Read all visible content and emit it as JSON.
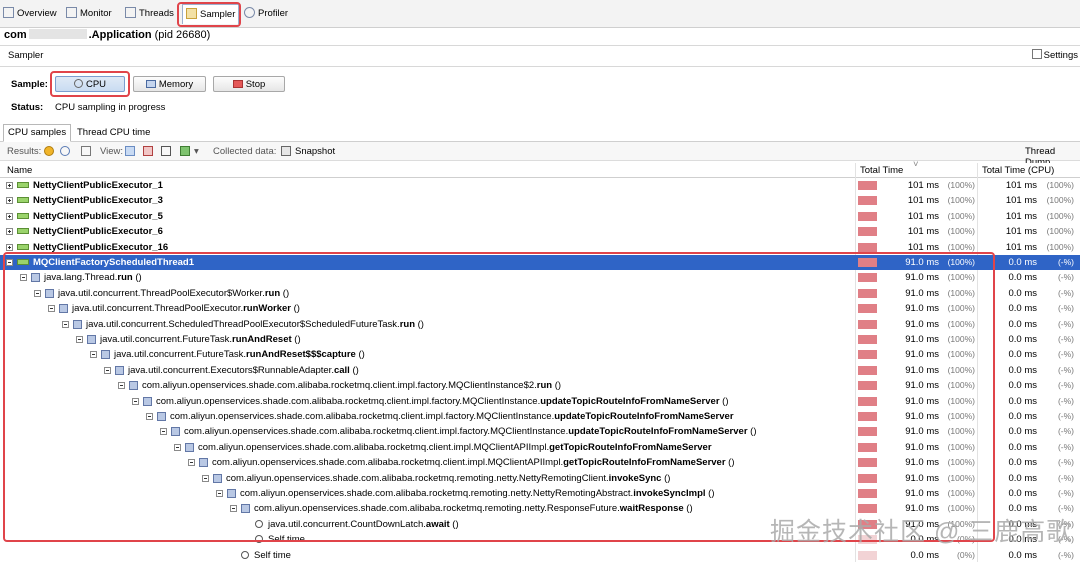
{
  "tabs": [
    {
      "label": "Overview",
      "icon": "overview-icon"
    },
    {
      "label": "Monitor",
      "icon": "monitor-icon"
    },
    {
      "label": "Threads",
      "icon": "threads-icon"
    },
    {
      "label": "Sampler",
      "icon": "sampler-icon"
    },
    {
      "label": "Profiler",
      "icon": "profiler-icon"
    }
  ],
  "app": {
    "title_prefix": "com",
    "title_suffix": ".Application",
    "pid": "(pid 26680)"
  },
  "panel": {
    "label": "Sampler",
    "settings": "Settings"
  },
  "sample": {
    "label": "Sample:",
    "cpu": "CPU",
    "memory": "Memory",
    "stop": "Stop"
  },
  "status": {
    "label": "Status:",
    "value": "CPU sampling in progress"
  },
  "subtabs": [
    "CPU samples",
    "Thread CPU time"
  ],
  "toolbar": {
    "results": "Results:",
    "view": "View:",
    "collected": "Collected data:",
    "snapshot": "Snapshot",
    "thread_dump": "Thread Dump"
  },
  "columns": {
    "name": "Name",
    "total": "Total Time",
    "total_cpu": "Total Time (CPU)"
  },
  "rows": [
    {
      "name": "NettyClientPublicExecutor_1",
      "bold": "",
      "suffix": "",
      "type": "thread",
      "depth": 0,
      "ms": "101 ms",
      "pct": "(100%)",
      "cms": "101 ms",
      "cpct": "(100%)",
      "bar": "full"
    },
    {
      "name": "NettyClientPublicExecutor_3",
      "bold": "",
      "suffix": "",
      "type": "thread",
      "depth": 0,
      "ms": "101 ms",
      "pct": "(100%)",
      "cms": "101 ms",
      "cpct": "(100%)",
      "bar": "full"
    },
    {
      "name": "NettyClientPublicExecutor_5",
      "bold": "",
      "suffix": "",
      "type": "thread",
      "depth": 0,
      "ms": "101 ms",
      "pct": "(100%)",
      "cms": "101 ms",
      "cpct": "(100%)",
      "bar": "full"
    },
    {
      "name": "NettyClientPublicExecutor_6",
      "bold": "",
      "suffix": "",
      "type": "thread",
      "depth": 0,
      "ms": "101 ms",
      "pct": "(100%)",
      "cms": "101 ms",
      "cpct": "(100%)",
      "bar": "full"
    },
    {
      "name": "NettyClientPublicExecutor_16",
      "bold": "",
      "suffix": "",
      "type": "thread",
      "depth": 0,
      "ms": "101 ms",
      "pct": "(100%)",
      "cms": "101 ms",
      "cpct": "(100%)",
      "bar": "full"
    },
    {
      "name": "MQClientFactoryScheduledThread1",
      "bold": "",
      "suffix": "",
      "type": "thread",
      "depth": 0,
      "ms": "91.0 ms",
      "pct": "(100%)",
      "cms": "0.0 ms",
      "cpct": "(-%)",
      "bar": "full",
      "selected": true
    },
    {
      "name": "java.lang.Thread.",
      "bold": "run",
      "suffix": " ()",
      "type": "method",
      "depth": 1,
      "ms": "91.0 ms",
      "pct": "(100%)",
      "cms": "0.0 ms",
      "cpct": "(-%)",
      "bar": "full"
    },
    {
      "name": "java.util.concurrent.ThreadPoolExecutor$Worker.",
      "bold": "run",
      "suffix": " ()",
      "type": "method",
      "depth": 2,
      "ms": "91.0 ms",
      "pct": "(100%)",
      "cms": "0.0 ms",
      "cpct": "(-%)",
      "bar": "full"
    },
    {
      "name": "java.util.concurrent.ThreadPoolExecutor.",
      "bold": "runWorker",
      "suffix": " ()",
      "type": "method",
      "depth": 3,
      "ms": "91.0 ms",
      "pct": "(100%)",
      "cms": "0.0 ms",
      "cpct": "(-%)",
      "bar": "full"
    },
    {
      "name": "java.util.concurrent.ScheduledThreadPoolExecutor$ScheduledFutureTask.",
      "bold": "run",
      "suffix": " ()",
      "type": "method",
      "depth": 4,
      "ms": "91.0 ms",
      "pct": "(100%)",
      "cms": "0.0 ms",
      "cpct": "(-%)",
      "bar": "full"
    },
    {
      "name": "java.util.concurrent.FutureTask.",
      "bold": "runAndReset",
      "suffix": " ()",
      "type": "method",
      "depth": 5,
      "ms": "91.0 ms",
      "pct": "(100%)",
      "cms": "0.0 ms",
      "cpct": "(-%)",
      "bar": "full"
    },
    {
      "name": "java.util.concurrent.FutureTask.",
      "bold": "runAndReset$$$capture",
      "suffix": " ()",
      "type": "method",
      "depth": 6,
      "ms": "91.0 ms",
      "pct": "(100%)",
      "cms": "0.0 ms",
      "cpct": "(-%)",
      "bar": "full"
    },
    {
      "name": "java.util.concurrent.Executors$RunnableAdapter.",
      "bold": "call",
      "suffix": " ()",
      "type": "method",
      "depth": 7,
      "ms": "91.0 ms",
      "pct": "(100%)",
      "cms": "0.0 ms",
      "cpct": "(-%)",
      "bar": "full"
    },
    {
      "name": "com.aliyun.openservices.shade.com.alibaba.rocketmq.client.impl.factory.MQClientInstance$2.",
      "bold": "run",
      "suffix": " ()",
      "type": "method",
      "depth": 8,
      "ms": "91.0 ms",
      "pct": "(100%)",
      "cms": "0.0 ms",
      "cpct": "(-%)",
      "bar": "full"
    },
    {
      "name": "com.aliyun.openservices.shade.com.alibaba.rocketmq.client.impl.factory.MQClientInstance.",
      "bold": "updateTopicRouteInfoFromNameServer",
      "suffix": " ()",
      "type": "method",
      "depth": 9,
      "ms": "91.0 ms",
      "pct": "(100%)",
      "cms": "0.0 ms",
      "cpct": "(-%)",
      "bar": "full"
    },
    {
      "name": "com.aliyun.openservices.shade.com.alibaba.rocketmq.client.impl.factory.MQClientInstance.",
      "bold": "updateTopicRouteInfoFromNameServer",
      "suffix": "",
      "type": "method",
      "depth": 10,
      "ms": "91.0 ms",
      "pct": "(100%)",
      "cms": "0.0 ms",
      "cpct": "(-%)",
      "bar": "full"
    },
    {
      "name": "com.aliyun.openservices.shade.com.alibaba.rocketmq.client.impl.factory.MQClientInstance.",
      "bold": "updateTopicRouteInfoFromNameServer",
      "suffix": " ()",
      "type": "method",
      "depth": 11,
      "ms": "91.0 ms",
      "pct": "(100%)",
      "cms": "0.0 ms",
      "cpct": "(-%)",
      "bar": "full"
    },
    {
      "name": "com.aliyun.openservices.shade.com.alibaba.rocketmq.client.impl.MQClientAPIImpl.",
      "bold": "getTopicRouteInfoFromNameServer",
      "suffix": "",
      "type": "method",
      "depth": 12,
      "ms": "91.0 ms",
      "pct": "(100%)",
      "cms": "0.0 ms",
      "cpct": "(-%)",
      "bar": "full"
    },
    {
      "name": "com.aliyun.openservices.shade.com.alibaba.rocketmq.client.impl.MQClientAPIImpl.",
      "bold": "getTopicRouteInfoFromNameServer",
      "suffix": " ()",
      "type": "method",
      "depth": 13,
      "ms": "91.0 ms",
      "pct": "(100%)",
      "cms": "0.0 ms",
      "cpct": "(-%)",
      "bar": "full"
    },
    {
      "name": "com.aliyun.openservices.shade.com.alibaba.rocketmq.remoting.netty.NettyRemotingClient.",
      "bold": "invokeSync",
      "suffix": " ()",
      "type": "method",
      "depth": 14,
      "ms": "91.0 ms",
      "pct": "(100%)",
      "cms": "0.0 ms",
      "cpct": "(-%)",
      "bar": "full"
    },
    {
      "name": "com.aliyun.openservices.shade.com.alibaba.rocketmq.remoting.netty.NettyRemotingAbstract.",
      "bold": "invokeSyncImpl",
      "suffix": " ()",
      "type": "method",
      "depth": 15,
      "ms": "91.0 ms",
      "pct": "(100%)",
      "cms": "0.0 ms",
      "cpct": "(-%)",
      "bar": "full"
    },
    {
      "name": "com.aliyun.openservices.shade.com.alibaba.rocketmq.remoting.netty.ResponseFuture.",
      "bold": "waitResponse",
      "suffix": " ()",
      "type": "method",
      "depth": 16,
      "ms": "91.0 ms",
      "pct": "(100%)",
      "cms": "0.0 ms",
      "cpct": "(-%)",
      "bar": "full"
    },
    {
      "name": "java.util.concurrent.CountDownLatch.",
      "bold": "await",
      "suffix": " ()",
      "type": "clock",
      "depth": 17,
      "ms": "91.0 ms",
      "pct": "(100%)",
      "cms": "0.0 ms",
      "cpct": "(-%)",
      "bar": "full"
    },
    {
      "name": "Self time",
      "bold": "",
      "suffix": "",
      "type": "clock",
      "depth": 17,
      "ms": "0.0 ms",
      "pct": "(0%)",
      "cms": "0.0 ms",
      "cpct": "(-%)",
      "bar": "empty"
    },
    {
      "name": "Self time",
      "bold": "",
      "suffix": "",
      "type": "clock",
      "depth": 16,
      "ms": "0.0 ms",
      "pct": "(0%)",
      "cms": "0.0 ms",
      "cpct": "(-%)",
      "bar": "empty"
    }
  ],
  "watermark": "掘金技术社区 @ 三鹿高歌",
  "colors": {
    "selection": "#2f64c6",
    "highlight": "#e0444a",
    "bar": "#e07f86"
  }
}
